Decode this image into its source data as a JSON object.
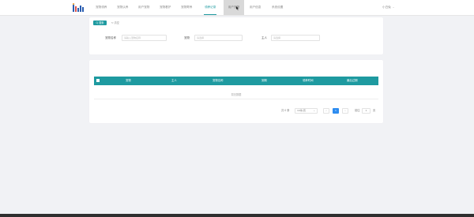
{
  "nav": {
    "items": [
      {
        "label": "宠物领养"
      },
      {
        "label": "宠物认养"
      },
      {
        "label": "用户宠物"
      },
      {
        "label": "宠物看护"
      },
      {
        "label": "宠物寄养"
      },
      {
        "label": "领养记录"
      },
      {
        "label": "用户宠物"
      },
      {
        "label": "用户信息"
      },
      {
        "label": "系统设置"
      }
    ],
    "active_index": 5,
    "hover_index": 6,
    "user_label": "小白兔"
  },
  "search": {
    "search_button": "Q 搜索",
    "reset_button": "清空",
    "fields": [
      {
        "label": "宠物名称",
        "placeholder": "请输入宠物名称"
      },
      {
        "label": "宠物",
        "placeholder": "请选择"
      },
      {
        "label": "主人",
        "placeholder": "请选择"
      }
    ]
  },
  "table": {
    "columns": [
      "宠物",
      "主人",
      "宠物名称",
      "到期",
      "领养时间",
      "最后过期"
    ],
    "empty_text": "暂无数据"
  },
  "pagination": {
    "total": "共 0 条",
    "page_size": "10条/页",
    "prev": "‹",
    "current_page": "1",
    "next": "›",
    "goto_label": "前往",
    "goto_value": "1",
    "page_suffix": "页"
  },
  "colors": {
    "accent": "#1e9aa0",
    "page_active": "#2d8cf0"
  }
}
